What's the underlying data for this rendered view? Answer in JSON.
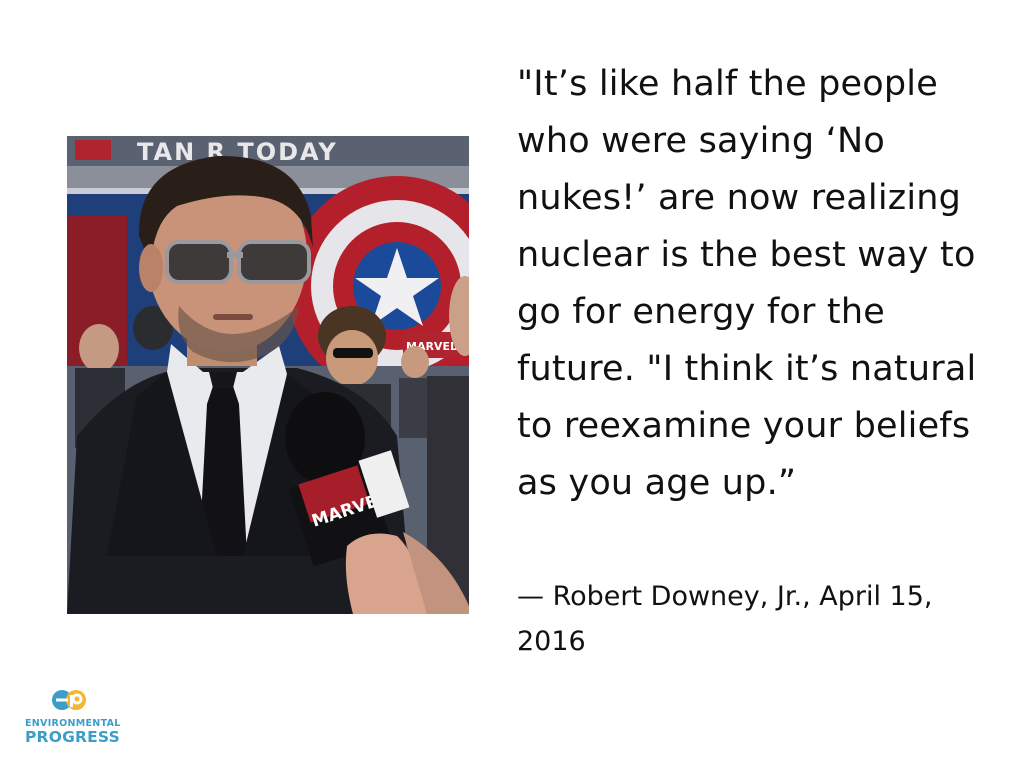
{
  "quote": {
    "lines": [
      "\"It’s like half the people",
      "who were saying ‘No",
      "nukes!’ are now realizing",
      "nuclear is the best way to",
      "go for energy for the",
      "future. \"I think it’s natural",
      "to reexamine your beliefs",
      "as you age up.”"
    ]
  },
  "attribution": {
    "lines": [
      "— Robert Downey, Jr., April 15,",
      "2016"
    ]
  },
  "photo": {
    "banner_text": "TAN  R TODAY",
    "backdrop_text": "MARVEL",
    "mic_flag_text": "MARVEL"
  },
  "logo": {
    "line1": "ENVIRONMENTAL",
    "line2": "PROGRESS"
  },
  "colors": {
    "text": "#111111",
    "logo_blue": "#3a9ec9",
    "logo_yellow": "#f2b632",
    "background": "#ffffff"
  }
}
